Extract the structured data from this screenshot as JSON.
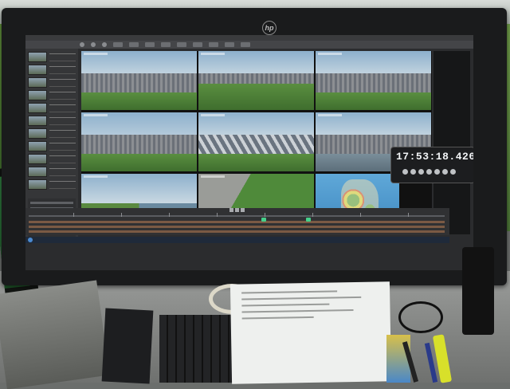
{
  "monitor": {
    "brand_logo": "hp"
  },
  "app": {
    "clock": "17:53:18.426",
    "video_feeds": [
      {
        "id": 1,
        "kind": "grandstand"
      },
      {
        "id": 2,
        "kind": "infield-track"
      },
      {
        "id": 3,
        "kind": "grandstand-wide"
      },
      {
        "id": 4,
        "kind": "grandstand-tower"
      },
      {
        "id": 5,
        "kind": "fence-camera"
      },
      {
        "id": 6,
        "kind": "tower-view"
      },
      {
        "id": 7,
        "kind": "lake-view"
      },
      {
        "id": 8,
        "kind": "pit-road"
      },
      {
        "id": 9,
        "kind": "weather-radar"
      }
    ]
  },
  "colors": {
    "timeline_marker": "#46d08a",
    "clock_text": "#f2f4f6"
  }
}
